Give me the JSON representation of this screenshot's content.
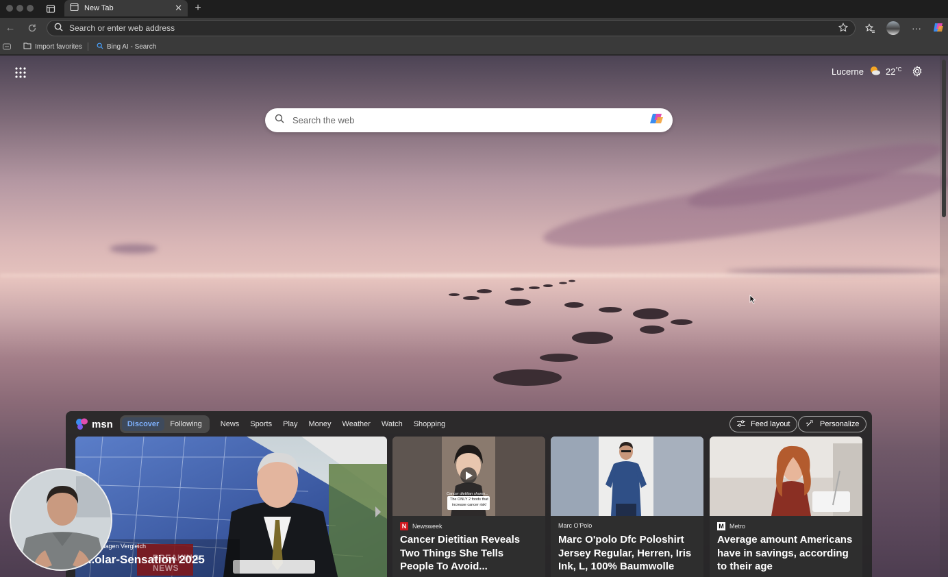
{
  "browser": {
    "tab_title": "New Tab",
    "address_placeholder": "Search or enter web address",
    "favorites": [
      {
        "label": "Import favorites"
      },
      {
        "label": "Bing AI - Search"
      }
    ]
  },
  "newtab": {
    "weather": {
      "city": "Lucerne",
      "temp": "22",
      "unit": "°C"
    },
    "search_placeholder": "Search the web"
  },
  "feed": {
    "brand": "msn",
    "pills": [
      "Discover",
      "Following"
    ],
    "links": [
      "News",
      "Sports",
      "Play",
      "Money",
      "Weather",
      "Watch",
      "Shopping"
    ],
    "feed_layout_label": "Feed layout",
    "personalize_label": "Personalize",
    "hero": {
      "source": "...lagen Vergleich",
      "headline": "...olar-Sensation 2025",
      "badge_line1": "BREAKING",
      "badge_line2": "NEWS"
    },
    "video_caption": {
      "line1": "Cancer dietitian shares...",
      "line2": "The ONLY 2 foods that",
      "line3": "increase cancer risk!"
    },
    "cards": [
      {
        "source": "Newsweek",
        "headline": "Cancer Dietitian Reveals Two Things She Tells People To Avoid..."
      },
      {
        "source": "Marc O'Polo",
        "headline": "Marc O'polo Dfc Poloshirt Jersey Regular, Herren, Iris Ink, L, 100% Baumwolle"
      },
      {
        "source": "Metro",
        "headline": "Average amount Americans have in savings, according to their age"
      }
    ]
  },
  "colors": {
    "accent": "#7fb2ff",
    "chrome_dark": "#1e1e1e",
    "chrome_mid": "#3a3a3a",
    "newsweek_red": "#d0181f"
  }
}
